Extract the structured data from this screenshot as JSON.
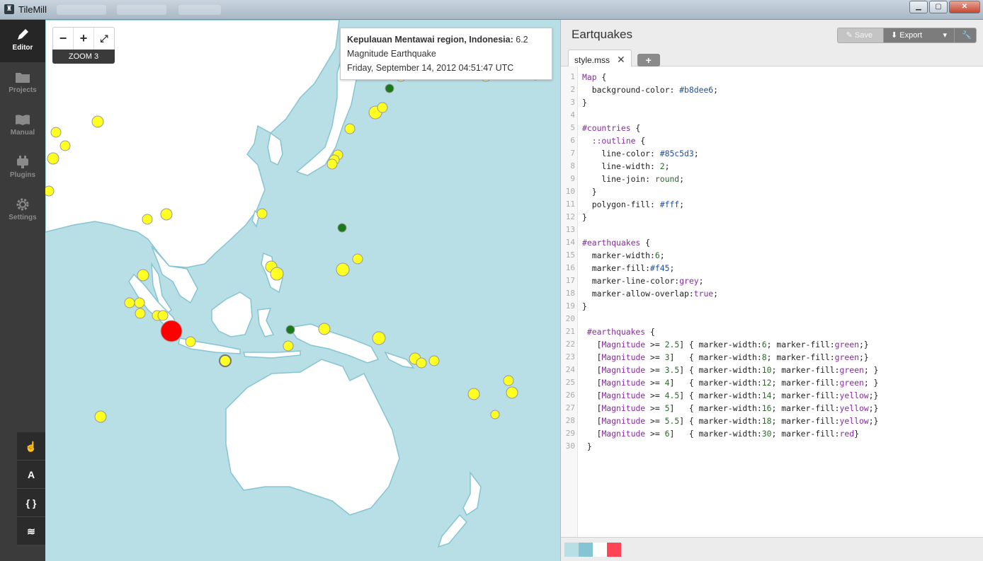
{
  "window": {
    "title": "TileMill"
  },
  "sidebar": {
    "items": [
      {
        "label": "Editor",
        "icon": "pencil-icon",
        "active": true
      },
      {
        "label": "Projects",
        "icon": "folder-icon",
        "active": false
      },
      {
        "label": "Manual",
        "icon": "book-icon",
        "active": false
      },
      {
        "label": "Plugins",
        "icon": "plugin-icon",
        "active": false
      },
      {
        "label": "Settings",
        "icon": "gear-icon",
        "active": false
      }
    ],
    "tools": [
      {
        "label": "☝",
        "icon": "hand-icon"
      },
      {
        "label": "A",
        "icon": "font-icon"
      },
      {
        "label": "{ }",
        "icon": "braces-icon"
      },
      {
        "label": "≋",
        "icon": "layers-icon"
      }
    ]
  },
  "map": {
    "zoom_out": "−",
    "zoom_in": "+",
    "fullscreen": "⤢",
    "zoom_level": "ZOOM 3",
    "tooltip": {
      "place": "Kepulauan Mentawai region, Indonesia:",
      "magnitude": "6.2",
      "type": "Magnitude Earthquake",
      "time": "Friday, September 14, 2012 04:51:47 UTC"
    },
    "colors": {
      "water": "#b8dee6",
      "land": "#ffffff",
      "outline": "#85c5d3"
    }
  },
  "editor": {
    "project_title": "Eartquakes",
    "save_label": "Save",
    "export_label": "Export",
    "tab_label": "style.mss",
    "tab_close": "✕",
    "tab_add": "+",
    "lines": [
      "Map {",
      "  background-color: #b8dee6;",
      "}",
      "",
      "#countries {",
      "  ::outline {",
      "    line-color: #85c5d3;",
      "    line-width: 2;",
      "    line-join: round;",
      "  }",
      "  polygon-fill: #fff;",
      "}",
      "",
      "#earthquakes {",
      "  marker-width:6;",
      "  marker-fill:#f45;",
      "  marker-line-color:grey;",
      "  marker-allow-overlap:true;",
      "}",
      "",
      " #earthquakes {",
      "   [Magnitude >= 2.5] { marker-width:6; marker-fill:green;}",
      "   [Magnitude >= 3]   { marker-width:8; marker-fill:green;}",
      "   [Magnitude >= 3.5] { marker-width:10; marker-fill:green; }",
      "   [Magnitude >= 4]   { marker-width:12; marker-fill:green; }",
      "   [Magnitude >= 4.5] { marker-width:14; marker-fill:yellow;}",
      "   [Magnitude >= 5]   { marker-width:16; marker-fill:yellow;}",
      "   [Magnitude >= 5.5] { marker-width:18; marker-fill:yellow;}",
      "   [Magnitude >= 6]   { marker-width:30; marker-fill:red}",
      " }"
    ],
    "swatches": [
      "#b8dee6",
      "#85c5d3",
      "#ffffff",
      "#ff4455"
    ]
  }
}
